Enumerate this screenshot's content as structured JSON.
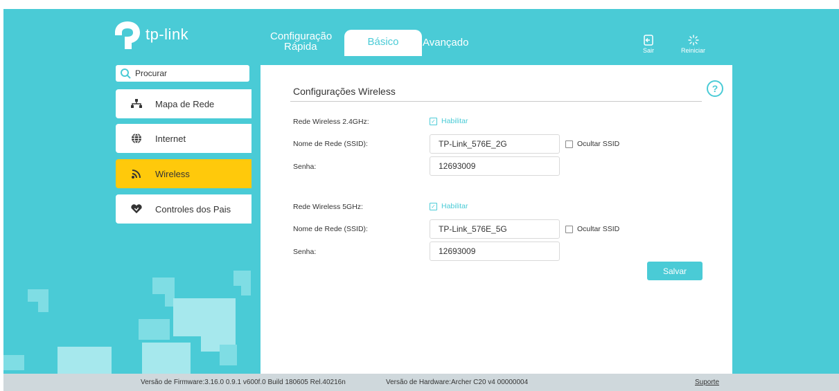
{
  "brand": {
    "name": "tp-link"
  },
  "nav": {
    "quick_setup_line1": "Configuração",
    "quick_setup_line2": "Rápida",
    "basic": "Básico",
    "advanced": "Avançado"
  },
  "top_buttons": {
    "logout": "Sair",
    "reboot": "Reiniciar"
  },
  "search": {
    "placeholder": "Procurar"
  },
  "sidebar": {
    "items": [
      {
        "label": "Mapa de Rede",
        "icon": "network-map-icon"
      },
      {
        "label": "Internet",
        "icon": "globe-icon"
      },
      {
        "label": "Wireless",
        "icon": "wireless-icon",
        "active": true
      },
      {
        "label": "Controles dos Pais",
        "icon": "heart-shield-icon"
      }
    ]
  },
  "main": {
    "title": "Configurações Wireless",
    "band24": {
      "label": "Rede Wireless 2.4GHz:",
      "enable": "Habilitar",
      "ssid_label": "Nome de Rede (SSID):",
      "ssid": "TP-Link_576E_2G",
      "hide": "Ocultar SSID",
      "password_label": "Senha:",
      "password": "12693009"
    },
    "band5": {
      "label": "Rede Wireless 5GHz:",
      "enable": "Habilitar",
      "ssid_label": "Nome de Rede (SSID):",
      "ssid": "TP-Link_576E_5G",
      "hide": "Ocultar SSID",
      "password_label": "Senha:",
      "password": "12693009"
    },
    "save": "Salvar"
  },
  "footer": {
    "firmware": "Versão de Firmware:3.16.0 0.9.1 v600f.0 Build 180605 Rel.40216n",
    "hardware": "Versão de Hardware:Archer C20 v4 00000004",
    "support": "Suporte"
  },
  "colors": {
    "accent": "#4acbd6",
    "active_menu": "#ffc90b",
    "background": "#4acbd6"
  }
}
